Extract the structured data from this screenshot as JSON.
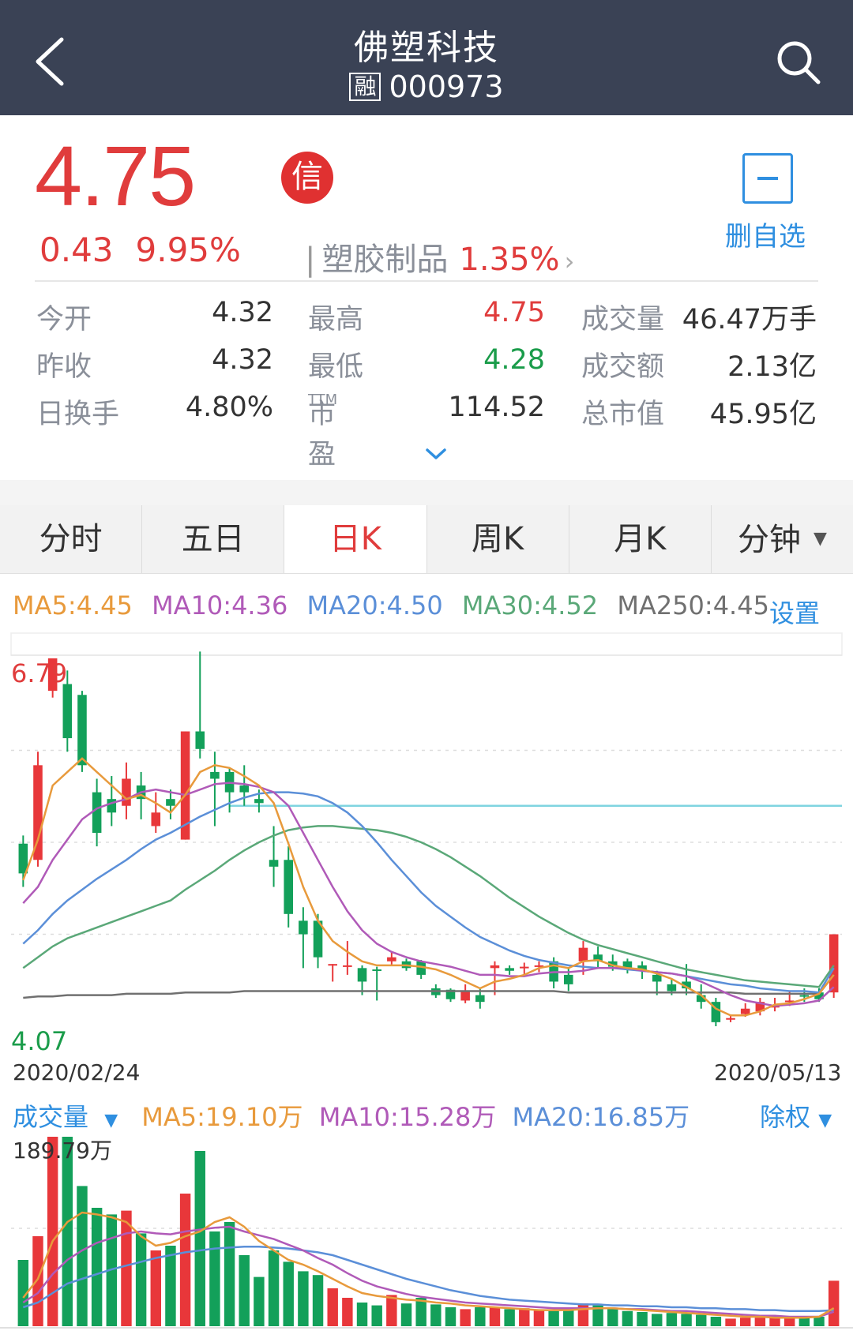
{
  "header": {
    "title": "佛塑科技",
    "badge": "融",
    "code": "000973"
  },
  "quote": {
    "price": "4.75",
    "xin_badge": "信",
    "change": "0.43",
    "change_pct": "9.95%",
    "sector_name": "塑胶制品",
    "sector_pct": "1.35%",
    "watchlist_label": "删自选"
  },
  "stats": [
    {
      "label": "今开",
      "value": "4.32",
      "label2": "最高",
      "value2": "4.75",
      "label3": "成交量",
      "value3": "46.47万手"
    },
    {
      "label": "昨收",
      "value": "4.32",
      "label2": "最低",
      "value2": "4.28",
      "label3": "成交额",
      "value3": "2.13亿"
    },
    {
      "label": "日换手",
      "value": "4.80%",
      "label2": "市盈",
      "sup": "TTM",
      "value2": "114.52",
      "label3": "总市值",
      "value3": "45.95亿"
    }
  ],
  "tabs": [
    "分时",
    "五日",
    "日K",
    "周K",
    "月K",
    "分钟"
  ],
  "active_tab": "日K",
  "ma": {
    "ma5": "MA5:4.45",
    "ma10": "MA10:4.36",
    "ma20": "MA20:4.50",
    "ma30": "MA30:4.52",
    "ma250": "MA250:4.45",
    "settings": "设置"
  },
  "colors": {
    "up": "#e8373a",
    "down": "#13a05a",
    "ma5": "#e89a3c",
    "ma10": "#b05ab8",
    "ma20": "#5b8fd8",
    "ma30": "#5aa878",
    "ma250": "#707070",
    "ref": "#7fd4e0",
    "blue": "#2f8fe0",
    "header_bg": "#3a4255"
  },
  "chart_data": [
    {
      "type": "candlestick",
      "y_max_label": "6.79",
      "y_min_label": "4.07",
      "ylim": [
        4.07,
        6.79
      ],
      "x_start": "2020/02/24",
      "x_end": "2020/05/13",
      "candles": [
        [
          5.42,
          5.2,
          5.48,
          5.1
        ],
        [
          5.3,
          6.0,
          6.1,
          5.25
        ],
        [
          6.55,
          6.79,
          6.79,
          6.5
        ],
        [
          6.6,
          6.2,
          6.7,
          6.1
        ],
        [
          6.52,
          6.0,
          6.55,
          5.95
        ],
        [
          5.8,
          5.5,
          5.9,
          5.4
        ],
        [
          5.75,
          5.65,
          5.92,
          5.55
        ],
        [
          5.7,
          5.9,
          6.02,
          5.6
        ],
        [
          5.85,
          5.75,
          5.95,
          5.6
        ],
        [
          5.55,
          5.65,
          5.8,
          5.5
        ],
        [
          5.75,
          5.7,
          5.82,
          5.6
        ],
        [
          5.45,
          6.25,
          6.25,
          5.45
        ],
        [
          6.25,
          6.12,
          6.84,
          6.05
        ],
        [
          5.95,
          5.9,
          6.1,
          5.55
        ],
        [
          5.95,
          5.8,
          5.98,
          5.65
        ],
        [
          5.85,
          5.8,
          6.0,
          5.7
        ],
        [
          5.75,
          5.72,
          5.82,
          5.65
        ],
        [
          5.3,
          5.25,
          5.55,
          5.1
        ],
        [
          5.3,
          4.9,
          5.4,
          4.8
        ],
        [
          4.85,
          4.75,
          4.95,
          4.5
        ],
        [
          4.85,
          4.58,
          4.9,
          4.5
        ],
        [
          4.53,
          4.53,
          4.53,
          4.4
        ],
        [
          4.52,
          4.52,
          4.7,
          4.45
        ],
        [
          4.5,
          4.4,
          4.52,
          4.3
        ],
        [
          4.49,
          4.48,
          4.51,
          4.26
        ],
        [
          4.55,
          4.58,
          4.62,
          4.52
        ],
        [
          4.55,
          4.5,
          4.57,
          4.48
        ],
        [
          4.55,
          4.45,
          4.56,
          4.42
        ],
        [
          4.35,
          4.3,
          4.38,
          4.28
        ],
        [
          4.34,
          4.27,
          4.35,
          4.25
        ],
        [
          4.26,
          4.33,
          4.38,
          4.24
        ],
        [
          4.3,
          4.25,
          4.35,
          4.2
        ],
        [
          4.5,
          4.52,
          4.55,
          4.3
        ],
        [
          4.5,
          4.48,
          4.52,
          4.45
        ],
        [
          4.5,
          4.51,
          4.54,
          4.45
        ],
        [
          4.52,
          4.52,
          4.55,
          4.47
        ],
        [
          4.55,
          4.4,
          4.58,
          4.35
        ],
        [
          4.45,
          4.38,
          4.5,
          4.33
        ],
        [
          4.55,
          4.65,
          4.7,
          4.45
        ],
        [
          4.6,
          4.55,
          4.66,
          4.5
        ],
        [
          4.55,
          4.51,
          4.6,
          4.48
        ],
        [
          4.55,
          4.5,
          4.57,
          4.46
        ],
        [
          4.52,
          4.48,
          4.55,
          4.42
        ],
        [
          4.45,
          4.4,
          4.48,
          4.3
        ],
        [
          4.38,
          4.33,
          4.42,
          4.3
        ],
        [
          4.4,
          4.35,
          4.53,
          4.3
        ],
        [
          4.3,
          4.25,
          4.38,
          4.2
        ],
        [
          4.25,
          4.1,
          4.28,
          4.07
        ],
        [
          4.12,
          4.13,
          4.15,
          4.1
        ],
        [
          4.16,
          4.2,
          4.24,
          4.14
        ],
        [
          4.18,
          4.25,
          4.28,
          4.15
        ],
        [
          4.22,
          4.22,
          4.28,
          4.18
        ],
        [
          4.26,
          4.26,
          4.33,
          4.22
        ],
        [
          4.3,
          4.29,
          4.35,
          4.25
        ],
        [
          4.32,
          4.27,
          4.35,
          4.25
        ],
        [
          4.32,
          4.75,
          4.75,
          4.28
        ]
      ],
      "ma5": [
        5.15,
        5.45,
        5.85,
        5.95,
        6.05,
        5.95,
        5.85,
        5.75,
        5.78,
        5.72,
        5.65,
        5.78,
        5.95,
        6.0,
        5.98,
        5.92,
        5.85,
        5.72,
        5.42,
        5.1,
        4.85,
        4.7,
        4.62,
        4.55,
        4.52,
        4.52,
        4.52,
        4.51,
        4.49,
        4.45,
        4.4,
        4.35,
        4.4,
        4.42,
        4.45,
        4.5,
        4.52,
        4.5,
        4.55,
        4.56,
        4.52,
        4.5,
        4.49,
        4.46,
        4.42,
        4.36,
        4.3,
        4.2,
        4.15,
        4.15,
        4.18,
        4.23,
        4.24,
        4.27,
        4.31,
        4.45
      ],
      "ma10": [
        4.98,
        5.1,
        5.3,
        5.45,
        5.6,
        5.68,
        5.72,
        5.75,
        5.8,
        5.82,
        5.8,
        5.78,
        5.82,
        5.86,
        5.87,
        5.86,
        5.84,
        5.8,
        5.7,
        5.5,
        5.3,
        5.1,
        4.92,
        4.78,
        4.68,
        4.62,
        4.58,
        4.55,
        4.53,
        4.51,
        4.48,
        4.45,
        4.45,
        4.44,
        4.44,
        4.46,
        4.47,
        4.47,
        4.48,
        4.5,
        4.5,
        4.5,
        4.48,
        4.47,
        4.46,
        4.44,
        4.4,
        4.35,
        4.3,
        4.26,
        4.24,
        4.22,
        4.23,
        4.24,
        4.26,
        4.36
      ],
      "ma20": [
        4.68,
        4.78,
        4.9,
        5.0,
        5.08,
        5.16,
        5.23,
        5.3,
        5.38,
        5.45,
        5.5,
        5.56,
        5.62,
        5.67,
        5.72,
        5.76,
        5.79,
        5.8,
        5.8,
        5.79,
        5.77,
        5.72,
        5.65,
        5.55,
        5.43,
        5.3,
        5.18,
        5.06,
        4.96,
        4.88,
        4.8,
        4.73,
        4.68,
        4.63,
        4.59,
        4.56,
        4.54,
        4.52,
        4.51,
        4.5,
        4.5,
        4.49,
        4.48,
        4.47,
        4.46,
        4.44,
        4.42,
        4.4,
        4.38,
        4.37,
        4.35,
        4.34,
        4.33,
        4.33,
        4.32,
        4.5
      ],
      "ma30": [
        4.5,
        4.58,
        4.66,
        4.72,
        4.76,
        4.8,
        4.84,
        4.88,
        4.92,
        4.96,
        5.0,
        5.08,
        5.15,
        5.22,
        5.3,
        5.37,
        5.43,
        5.48,
        5.52,
        5.54,
        5.55,
        5.55,
        5.54,
        5.53,
        5.52,
        5.5,
        5.47,
        5.43,
        5.38,
        5.32,
        5.25,
        5.18,
        5.1,
        5.02,
        4.95,
        4.88,
        4.82,
        4.76,
        4.71,
        4.67,
        4.64,
        4.61,
        4.58,
        4.55,
        4.52,
        4.49,
        4.47,
        4.45,
        4.43,
        4.41,
        4.4,
        4.39,
        4.38,
        4.37,
        4.36,
        4.52
      ],
      "ma250": [
        4.28,
        4.29,
        4.29,
        4.3,
        4.3,
        4.3,
        4.3,
        4.31,
        4.31,
        4.31,
        4.31,
        4.32,
        4.32,
        4.32,
        4.32,
        4.33,
        4.33,
        4.33,
        4.33,
        4.33,
        4.33,
        4.33,
        4.33,
        4.33,
        4.33,
        4.33,
        4.33,
        4.33,
        4.33,
        4.33,
        4.33,
        4.33,
        4.33,
        4.33,
        4.33,
        4.33,
        4.33,
        4.32,
        4.32,
        4.32,
        4.32,
        4.32,
        4.32,
        4.32,
        4.32,
        4.32,
        4.32,
        4.32,
        4.32,
        4.31,
        4.31,
        4.31,
        4.31,
        4.31,
        4.31,
        4.45
      ],
      "reference_level": 5.7
    },
    {
      "type": "bar",
      "title": "成交量",
      "y_max_label": "189.79万",
      "ma5_label": "MA5:19.10万",
      "ma10_label": "MA10:15.28万",
      "ma20_label": "MA20:16.85万",
      "fuquan_label": "除权",
      "volumes": [
        70,
        95,
        200,
        200,
        148,
        125,
        118,
        122,
        98,
        80,
        85,
        140,
        185,
        100,
        110,
        75,
        52,
        80,
        68,
        58,
        54,
        40,
        30,
        25,
        22,
        33,
        24,
        30,
        23,
        20,
        18,
        20,
        20,
        18,
        19,
        17,
        16,
        18,
        24,
        22,
        18,
        16,
        15,
        13,
        14,
        13,
        12,
        10,
        8,
        9,
        9,
        9,
        9,
        10,
        10,
        48
      ],
      "ma5": [
        30,
        50,
        90,
        110,
        120,
        118,
        115,
        110,
        95,
        85,
        88,
        95,
        100,
        110,
        115,
        105,
        90,
        80,
        70,
        65,
        58,
        50,
        42,
        35,
        32,
        30,
        28,
        27,
        25,
        24,
        22,
        21,
        20,
        19,
        18,
        17,
        17,
        17,
        18,
        19,
        19,
        18,
        17,
        16,
        15,
        14,
        13,
        12,
        11,
        10,
        10,
        9,
        9,
        9,
        10,
        19.1
      ],
      "ma10": [
        25,
        35,
        55,
        70,
        80,
        88,
        93,
        98,
        100,
        98,
        97,
        100,
        102,
        104,
        105,
        100,
        96,
        92,
        86,
        80,
        72,
        65,
        56,
        48,
        42,
        38,
        34,
        31,
        29,
        27,
        25,
        24,
        23,
        22,
        21,
        20,
        19,
        19,
        19,
        19,
        19,
        18,
        18,
        17,
        16,
        16,
        15,
        14,
        13,
        12,
        11,
        11,
        10,
        10,
        10,
        15.28
      ],
      "ma20": [
        20,
        25,
        35,
        45,
        50,
        55,
        60,
        64,
        68,
        72,
        75,
        78,
        80,
        82,
        83,
        84,
        84,
        83,
        82,
        80,
        78,
        75,
        70,
        65,
        60,
        55,
        50,
        46,
        42,
        38,
        35,
        32,
        30,
        28,
        27,
        26,
        25,
        24,
        23,
        23,
        22,
        22,
        21,
        21,
        20,
        20,
        19,
        19,
        18,
        18,
        17,
        17,
        16,
        16,
        16,
        16.85
      ],
      "vmax": 200
    }
  ]
}
